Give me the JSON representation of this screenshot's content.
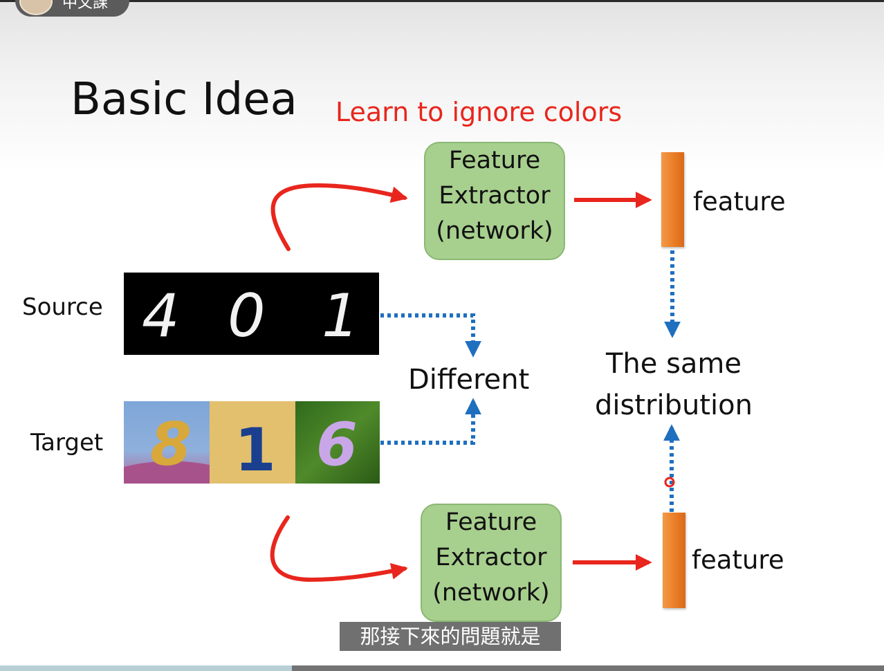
{
  "player": {
    "channel_name": "中文課",
    "subtitle": "那接下來的問題就是",
    "progress": 0.33
  },
  "slide": {
    "title": "Basic Idea",
    "note": "Learn to ignore colors",
    "feature_extractor_top": [
      "Feature",
      "Extractor",
      "(network)"
    ],
    "feature_extractor_bottom": [
      "Feature",
      "Extractor",
      "(network)"
    ],
    "feature_label_top": "feature",
    "feature_label_bottom": "feature",
    "source_label": "Source",
    "target_label": "Target",
    "different_label": "Different",
    "same_distribution": [
      "The same",
      "distribution"
    ],
    "source_digits": [
      "4",
      "0",
      "1"
    ],
    "target_digits": [
      "8",
      "1",
      "6"
    ]
  },
  "colors": {
    "arrow_red": "#e8261d",
    "arrow_blue": "#1f6fbf",
    "extractor_fill": "#a7cf8e",
    "feature_bar": "#f08b35",
    "note_red": "#e8261d"
  }
}
